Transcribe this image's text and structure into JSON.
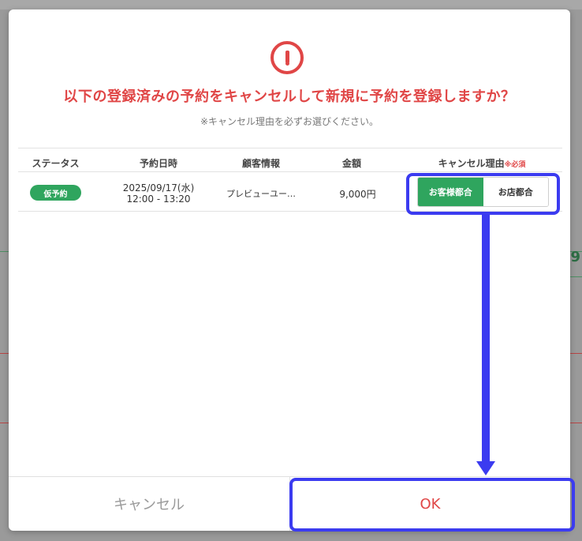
{
  "dialog": {
    "title": "以下の登録済みの予約をキャンセルして新規に予約を登録しますか？",
    "subtitle": "※キャンセル理由を必ずお選びください。",
    "table": {
      "headers": {
        "status": "ステータス",
        "datetime": "予約日時",
        "customer": "顧客情報",
        "amount": "金額",
        "reason": "キャンセル理由",
        "reason_required": "※必須"
      },
      "rows": [
        {
          "status": "仮予約",
          "date": "2025/09/17(水)",
          "time": "12:00 - 13:20",
          "customer": "プレビューユー…",
          "amount": "9,000円",
          "reason_options": [
            "お客様都合",
            "お店都合"
          ],
          "reason_selected": "お客様都合"
        }
      ]
    },
    "buttons": {
      "cancel": "キャンセル",
      "ok": "OK"
    }
  },
  "background": {
    "partial_number": "9"
  },
  "colors": {
    "accent_red": "#e04646",
    "status_green": "#2fa55e",
    "annotation_blue": "#3b3bf0"
  },
  "icons": {
    "alert": "alert-circle-icon"
  }
}
